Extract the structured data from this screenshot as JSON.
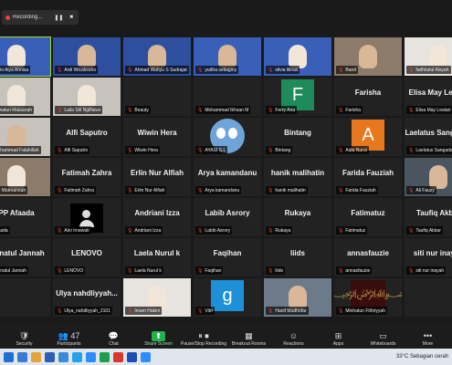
{
  "recording": {
    "label": "Recording...",
    "pause_icon": "pause-icon",
    "stop_icon": "stop-icon"
  },
  "tiles": [
    {
      "type": "video",
      "name": "Siski Alya Annisa",
      "variant": "",
      "speaking": true,
      "shape": "hijab"
    },
    {
      "type": "video",
      "name": "Ardi Wicaksono",
      "variant": "v2",
      "shape": "face"
    },
    {
      "type": "video",
      "name": "Ahmad Wahyu S Sudrajat",
      "variant": "v2",
      "shape": "face"
    },
    {
      "type": "video",
      "name": "yudha setiaginy",
      "variant": "",
      "shape": "face"
    },
    {
      "type": "video",
      "name": "silvia lilinas",
      "variant": "",
      "shape": "hijab"
    },
    {
      "type": "video",
      "name": "Band",
      "variant": "v6",
      "shape": "face"
    },
    {
      "type": "video",
      "name": "fadhilatul Aisyah",
      "variant": "v7",
      "shape": "hijab"
    },
    {
      "type": "video",
      "name": "",
      "variant": "v4",
      "shape": "face"
    },
    {
      "type": "video",
      "name": "uswatun khasanah",
      "variant": "v5",
      "shape": "hijab"
    },
    {
      "type": "video",
      "name": "Laila Siti Ngilfatun",
      "variant": "v5",
      "shape": "hijab"
    },
    {
      "type": "name",
      "name": "Beauty",
      "big": ""
    },
    {
      "type": "name",
      "name": "Mohammad Ikhsan M",
      "big": ""
    },
    {
      "type": "letter",
      "name": "Ferry Ana",
      "letter": "F",
      "color": "#1e8c5a"
    },
    {
      "type": "name",
      "name": "Farisha",
      "big": "Farisha"
    },
    {
      "type": "name",
      "name": "Elisa May Lestari",
      "big": "Elisa May Lestari"
    },
    {
      "type": "name",
      "name": "",
      "big": ""
    },
    {
      "type": "video",
      "name": "Muhammad Falahillah",
      "variant": "v5",
      "shape": "face"
    },
    {
      "type": "name",
      "name": "Alfi Saputro",
      "big": "Alfi Saputro"
    },
    {
      "type": "name",
      "name": "Wiwin Hera",
      "big": "Wiwin Hera"
    },
    {
      "type": "cartoon",
      "name": "AYASI S.L"
    },
    {
      "type": "name",
      "name": "Bintang",
      "big": "Bintang"
    },
    {
      "type": "letter",
      "name": "Aida Nurul",
      "letter": "A",
      "color": "#e8781e"
    },
    {
      "type": "name",
      "name": "Laelatus Sangadah",
      "big": "Laelatus Sangadah"
    },
    {
      "type": "name",
      "name": "",
      "big": ""
    },
    {
      "type": "video",
      "name": "Siti Mutmannah",
      "variant": "v6",
      "shape": "hijab"
    },
    {
      "type": "name",
      "name": "Fatimah Zahra",
      "big": "Fatimah Zahra"
    },
    {
      "type": "name",
      "name": "Erlin Nur Alfiah",
      "big": "Erlin Nur Alfiah"
    },
    {
      "type": "name",
      "name": "Arya kamandanu",
      "big": "Arya kamandanu"
    },
    {
      "type": "name",
      "name": "hanik malihatin",
      "big": "hanik malihatin"
    },
    {
      "type": "name",
      "name": "Farida Fauziah",
      "big": "Farida Fauziah"
    },
    {
      "type": "video",
      "name": "Ali Fauzy",
      "variant": "v4",
      "shape": "face"
    },
    {
      "type": "name",
      "name": "",
      "big": ""
    },
    {
      "type": "name",
      "name": "Maada",
      "big": "PP Afaada"
    },
    {
      "type": "person",
      "name": "Aini Irnawati"
    },
    {
      "type": "name",
      "name": "Andriani Izza",
      "big": "Andriani Izza"
    },
    {
      "type": "name",
      "name": "Labib Asrory",
      "big": "Labib Asrory"
    },
    {
      "type": "name",
      "name": "Rukaya",
      "big": "Rukaya"
    },
    {
      "type": "name",
      "name": "Fatimatuz",
      "big": "Fatimatuz"
    },
    {
      "type": "name",
      "name": "Taufiq Akbar",
      "big": "Taufiq Akbar"
    },
    {
      "type": "name",
      "name": "",
      "big": ""
    },
    {
      "type": "name",
      "name": "Munatul Jannah",
      "big": "munatul Jannah"
    },
    {
      "type": "name",
      "name": "LENOVO",
      "big": "LENOVO"
    },
    {
      "type": "name",
      "name": "Laela Nurul k",
      "big": "Laela Nurul k"
    },
    {
      "type": "name",
      "name": "Faqihan",
      "big": "Faqihan"
    },
    {
      "type": "name",
      "name": "liids",
      "big": "liids"
    },
    {
      "type": "name",
      "name": "annasfauzie",
      "big": "annasfauzie"
    },
    {
      "type": "name",
      "name": "siti nur inayah",
      "big": "siti nur inayah"
    },
    {
      "type": "name",
      "name": "",
      "big": ""
    },
    {
      "type": "name",
      "name": "",
      "big": ""
    },
    {
      "type": "name",
      "name": "Ulya_nahdliyyah_2101",
      "big": "Ulya nahdliyyah..."
    },
    {
      "type": "video",
      "name": "Imam Hakim",
      "variant": "v7",
      "shape": "hijab"
    },
    {
      "type": "letter",
      "name": "Vitri",
      "letter": "g",
      "color": "#1e90d8"
    },
    {
      "type": "video",
      "name": "Hanif Mudhofar",
      "variant": "v3",
      "shape": "face"
    },
    {
      "type": "calligraphy",
      "name": "Minhatun Fithriyyah"
    },
    {
      "type": "name",
      "name": "",
      "big": ""
    },
    {
      "type": "name",
      "name": "",
      "big": ""
    }
  ],
  "toolbar": [
    {
      "label": "Security",
      "icon": "shield-icon",
      "glyph": "🛡"
    },
    {
      "label": "Participants",
      "icon": "participants-icon",
      "glyph": "👥 47"
    },
    {
      "label": "Chat",
      "icon": "chat-icon",
      "glyph": "💬"
    },
    {
      "label": "Share Screen",
      "icon": "share-screen-icon",
      "glyph": "⬆",
      "share": true
    },
    {
      "label": "Pause/Stop Recording",
      "icon": "recording-icon",
      "glyph": "⏸ ⏹"
    },
    {
      "label": "Breakout Rooms",
      "icon": "breakout-rooms-icon",
      "glyph": "▦"
    },
    {
      "label": "Reactions",
      "icon": "reactions-icon",
      "glyph": "☺"
    },
    {
      "label": "Apps",
      "icon": "apps-icon",
      "glyph": "⊞"
    },
    {
      "label": "Whiteboards",
      "icon": "whiteboard-icon",
      "glyph": "▭"
    },
    {
      "label": "More",
      "icon": "more-icon",
      "glyph": "•••"
    }
  ],
  "taskbar": {
    "icons": [
      "#3a7bd5",
      "#e8a23a",
      "#2f5fb5",
      "#3b8ad8",
      "#24a0ed",
      "#2d8cff",
      "#1e9e4a",
      "#d8382f",
      "#1e4db7",
      "#2d8cff"
    ],
    "weather": "33°C  Sebagian cerah"
  }
}
